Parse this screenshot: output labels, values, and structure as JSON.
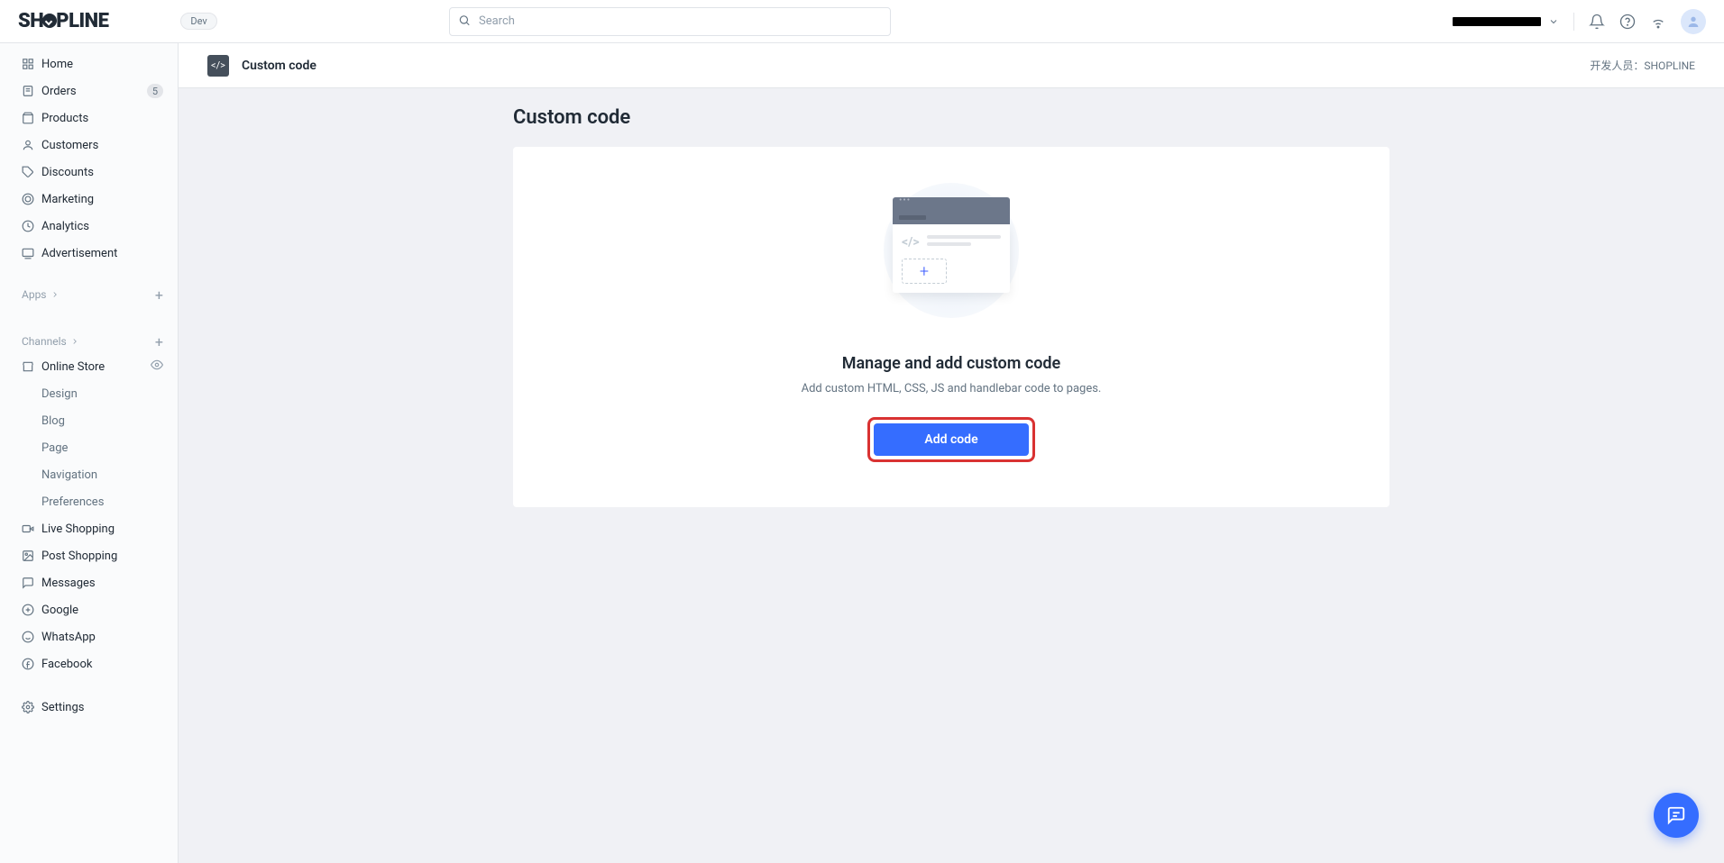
{
  "header": {
    "logo_text": "SHOPLINE",
    "dev_pill": "Dev",
    "search_placeholder": "Search",
    "store_name": "",
    "dev_credit_prefix": "开发人员：",
    "dev_credit_name": "SHOPLINE"
  },
  "sidebar": {
    "main": [
      {
        "icon": "home",
        "label": "Home"
      },
      {
        "icon": "orders",
        "label": "Orders",
        "badge": "5"
      },
      {
        "icon": "products",
        "label": "Products"
      },
      {
        "icon": "customers",
        "label": "Customers"
      },
      {
        "icon": "discounts",
        "label": "Discounts"
      },
      {
        "icon": "marketing",
        "label": "Marketing"
      },
      {
        "icon": "analytics",
        "label": "Analytics"
      },
      {
        "icon": "advertisement",
        "label": "Advertisement"
      }
    ],
    "apps_section": "Apps",
    "channels_section": "Channels",
    "channels": [
      {
        "icon": "online-store",
        "label": "Online Store",
        "eye": true,
        "sub": [
          {
            "label": "Design"
          },
          {
            "label": "Blog"
          },
          {
            "label": "Page"
          },
          {
            "label": "Navigation"
          },
          {
            "label": "Preferences"
          }
        ]
      },
      {
        "icon": "live",
        "label": "Live Shopping"
      },
      {
        "icon": "post",
        "label": "Post Shopping"
      },
      {
        "icon": "messages",
        "label": "Messages"
      },
      {
        "icon": "google",
        "label": "Google"
      },
      {
        "icon": "whatsapp",
        "label": "WhatsApp"
      },
      {
        "icon": "facebook",
        "label": "Facebook"
      }
    ],
    "settings": {
      "icon": "settings",
      "label": "Settings"
    }
  },
  "page_header": {
    "title": "Custom code"
  },
  "content": {
    "heading": "Custom code",
    "empty_title": "Manage and add custom code",
    "empty_desc": "Add custom HTML, CSS, JS and handlebar code to pages.",
    "add_btn": "Add code"
  }
}
